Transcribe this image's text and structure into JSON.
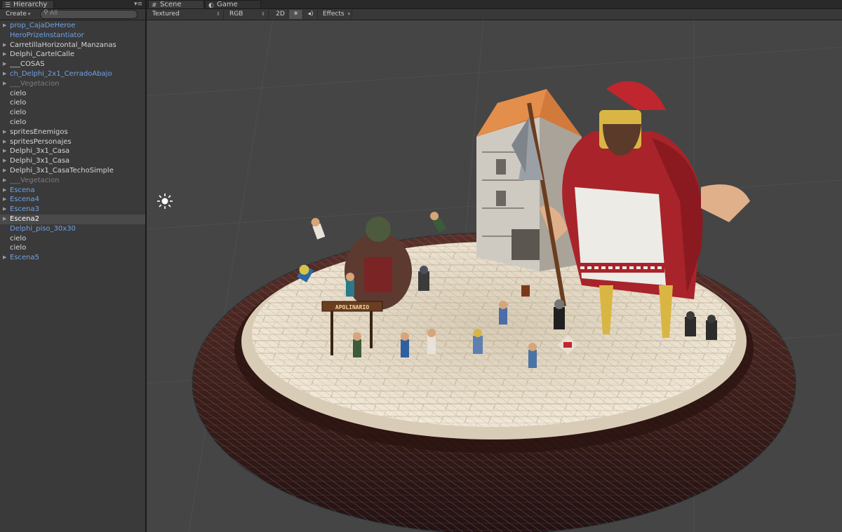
{
  "hierarchy": {
    "tab_label": "Hierarchy",
    "create_label": "Create",
    "search_placeholder": "All",
    "items": [
      {
        "label": "prop_CajaDeHeroe",
        "color": "blue",
        "expandable": true
      },
      {
        "label": "HeroPrizeInstantiator",
        "color": "blue",
        "expandable": false
      },
      {
        "label": "CarretillaHorizontal_Manzanas",
        "color": "white",
        "expandable": true
      },
      {
        "label": "Delphi_CartelCalle",
        "color": "white",
        "expandable": true
      },
      {
        "label": "___COSAS",
        "color": "white",
        "expandable": true
      },
      {
        "label": "ch_Delphi_2x1_CerradoAbajo",
        "color": "blue",
        "expandable": true
      },
      {
        "label": "___Vegetacion",
        "color": "gray",
        "expandable": true
      },
      {
        "label": "cielo",
        "color": "white",
        "expandable": false
      },
      {
        "label": "cielo",
        "color": "white",
        "expandable": false
      },
      {
        "label": "cielo",
        "color": "white",
        "expandable": false
      },
      {
        "label": "cielo",
        "color": "white",
        "expandable": false
      },
      {
        "label": "spritesEnemigos",
        "color": "white",
        "expandable": true
      },
      {
        "label": "spritesPersonajes",
        "color": "white",
        "expandable": true
      },
      {
        "label": "Delphi_3x1_Casa",
        "color": "white",
        "expandable": true
      },
      {
        "label": "Delphi_3x1_Casa",
        "color": "white",
        "expandable": true
      },
      {
        "label": "Delphi_3x1_CasaTechoSimple",
        "color": "white",
        "expandable": true
      },
      {
        "label": "___Vegetacion",
        "color": "gray",
        "expandable": true
      },
      {
        "label": "Escena",
        "color": "blue",
        "expandable": true
      },
      {
        "label": "Escena4",
        "color": "blue",
        "expandable": true
      },
      {
        "label": "Escena3",
        "color": "blue",
        "expandable": true
      },
      {
        "label": "Escena2",
        "color": "white",
        "expandable": true,
        "selected": true
      },
      {
        "label": "Delphi_piso_30x30",
        "color": "blue",
        "expandable": false
      },
      {
        "label": "cielo",
        "color": "white",
        "expandable": false
      },
      {
        "label": "cielo",
        "color": "white",
        "expandable": false
      },
      {
        "label": "Escena5",
        "color": "blue",
        "expandable": true
      }
    ]
  },
  "scene": {
    "tabs": [
      {
        "label": "Scene",
        "icon": "grid-icon",
        "active": true
      },
      {
        "label": "Game",
        "icon": "pacman-icon",
        "active": false
      }
    ],
    "toolbar": {
      "draw_mode": "Textured",
      "render_mode": "RGB",
      "mode_2d": "2D",
      "lighting_icon": "sun-icon",
      "audio_icon": "speaker-icon",
      "effects_label": "Effects"
    },
    "sign_text": "APOLINARIO"
  },
  "colors": {
    "blue_text": "#6fa2e6",
    "gray_text": "#7d7d7d",
    "panel_bg": "#3a3a3a",
    "viewport_bg": "#454545",
    "ring_color": "#3c1f18",
    "plaza_color": "#e8dcc6",
    "cape_red": "#a8242a"
  }
}
